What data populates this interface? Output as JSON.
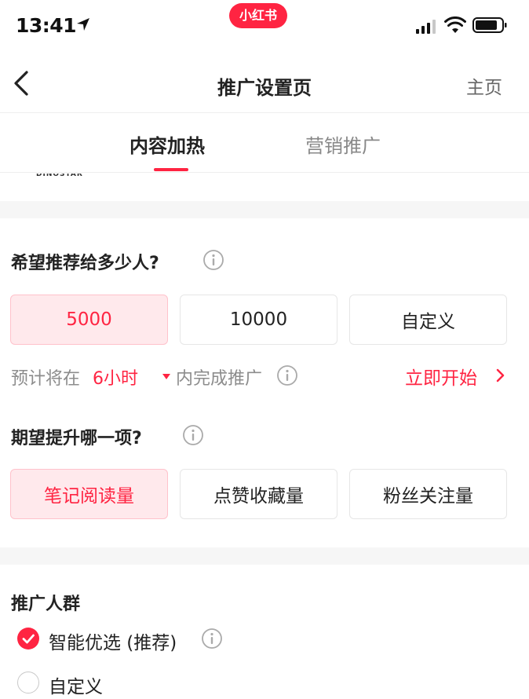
{
  "status_bar": {
    "time": "13:41",
    "app_badge": "小红书"
  },
  "navbar": {
    "title": "推广设置页",
    "home_link": "主页"
  },
  "tabs": [
    {
      "label": "内容加热",
      "active": true
    },
    {
      "label": "营销推广",
      "active": false
    }
  ],
  "clipped_logo_text": "DINOSTAR",
  "audience_size": {
    "title": "希望推荐给多少人?",
    "options": [
      {
        "label": "5000",
        "selected": true
      },
      {
        "label": "10000",
        "selected": false
      },
      {
        "label": "自定义",
        "selected": false
      }
    ]
  },
  "estimate": {
    "prefix": "预计将在",
    "duration": "6小时",
    "suffix": "内完成推广",
    "action": "立即开始"
  },
  "goal": {
    "title": "期望提升哪一项?",
    "options": [
      {
        "label": "笔记阅读量",
        "selected": true
      },
      {
        "label": "点赞收藏量",
        "selected": false
      },
      {
        "label": "粉丝关注量",
        "selected": false
      }
    ]
  },
  "audience_targeting": {
    "title": "推广人群",
    "options": [
      {
        "label": "智能优选 (推荐)",
        "checked": true
      },
      {
        "label": "自定义",
        "checked": false
      }
    ]
  },
  "colors": {
    "accent": "#ff2442",
    "selected_bg": "#ffe9ec",
    "muted_text": "#8c8c8c",
    "gap_band": "#f6f6f6"
  },
  "icons": {
    "location": "location-arrow-icon",
    "signal": "cellular-signal-icon",
    "wifi": "wifi-icon",
    "battery": "battery-icon",
    "back": "chevron-left-icon",
    "info": "info-circle-icon",
    "chevron_right": "chevron-right-icon",
    "check": "check-icon",
    "dropdown": "triangle-down-icon"
  }
}
